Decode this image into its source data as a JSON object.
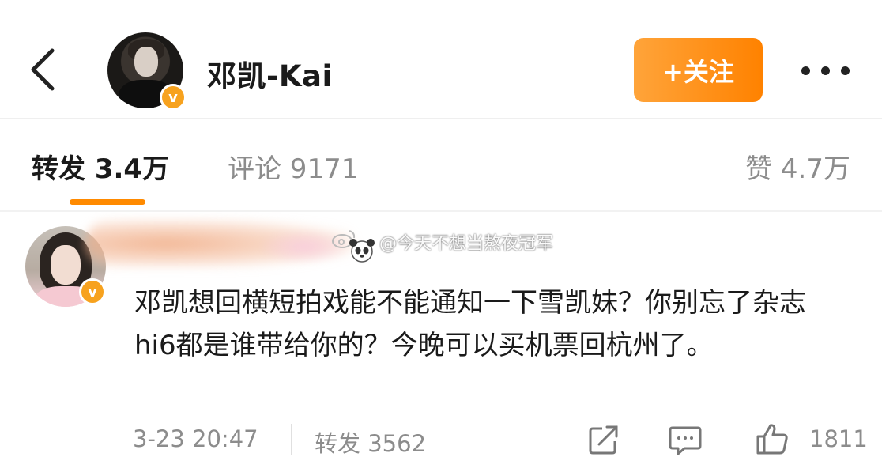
{
  "header": {
    "username": "邓凯-Kai",
    "follow_label": "+关注",
    "badge": "v"
  },
  "tabs": {
    "repost": "转发 3.4万",
    "comment": "评论 9171",
    "like": "赞 4.7万"
  },
  "post": {
    "badge": "v",
    "watermark": "@今天不想当熬夜冠军",
    "text": "邓凯想回横短拍戏能不能通知一下雪凯妹？你别忘了杂志hi6都是谁带给你的？今晚可以买机票回杭州了。",
    "time": "3-23 20:47",
    "repost_label": "转发 3562",
    "like_count": "1811"
  },
  "colors": {
    "accent": "#ff8200",
    "badge": "#f7a21e",
    "muted_text": "#8c8c8c"
  },
  "icons": [
    "back-arrow-icon",
    "more-dots-icon",
    "verified-badge-icon",
    "share-icon",
    "comment-icon",
    "like-icon"
  ]
}
